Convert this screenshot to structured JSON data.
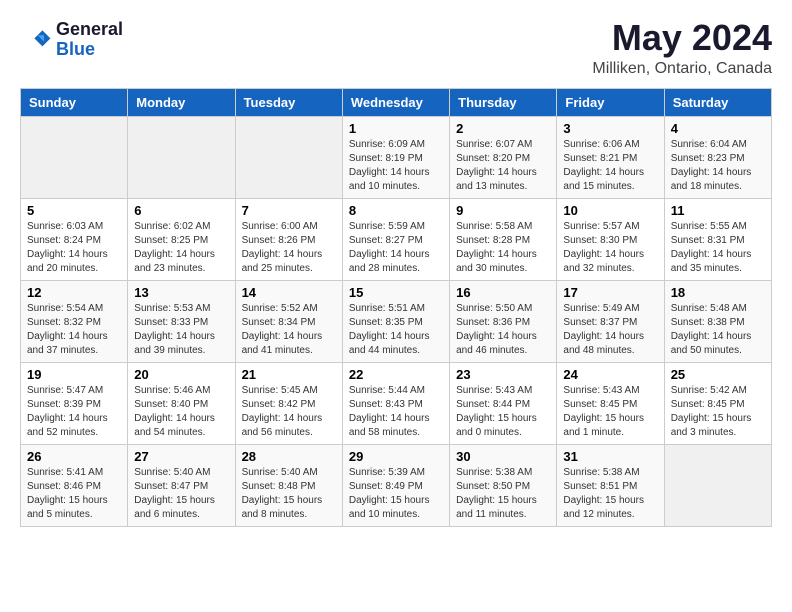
{
  "header": {
    "logo_line1": "General",
    "logo_line2": "Blue",
    "month": "May 2024",
    "location": "Milliken, Ontario, Canada"
  },
  "days_of_week": [
    "Sunday",
    "Monday",
    "Tuesday",
    "Wednesday",
    "Thursday",
    "Friday",
    "Saturday"
  ],
  "weeks": [
    [
      {
        "day": "",
        "info": ""
      },
      {
        "day": "",
        "info": ""
      },
      {
        "day": "",
        "info": ""
      },
      {
        "day": "1",
        "info": "Sunrise: 6:09 AM\nSunset: 8:19 PM\nDaylight: 14 hours\nand 10 minutes."
      },
      {
        "day": "2",
        "info": "Sunrise: 6:07 AM\nSunset: 8:20 PM\nDaylight: 14 hours\nand 13 minutes."
      },
      {
        "day": "3",
        "info": "Sunrise: 6:06 AM\nSunset: 8:21 PM\nDaylight: 14 hours\nand 15 minutes."
      },
      {
        "day": "4",
        "info": "Sunrise: 6:04 AM\nSunset: 8:23 PM\nDaylight: 14 hours\nand 18 minutes."
      }
    ],
    [
      {
        "day": "5",
        "info": "Sunrise: 6:03 AM\nSunset: 8:24 PM\nDaylight: 14 hours\nand 20 minutes."
      },
      {
        "day": "6",
        "info": "Sunrise: 6:02 AM\nSunset: 8:25 PM\nDaylight: 14 hours\nand 23 minutes."
      },
      {
        "day": "7",
        "info": "Sunrise: 6:00 AM\nSunset: 8:26 PM\nDaylight: 14 hours\nand 25 minutes."
      },
      {
        "day": "8",
        "info": "Sunrise: 5:59 AM\nSunset: 8:27 PM\nDaylight: 14 hours\nand 28 minutes."
      },
      {
        "day": "9",
        "info": "Sunrise: 5:58 AM\nSunset: 8:28 PM\nDaylight: 14 hours\nand 30 minutes."
      },
      {
        "day": "10",
        "info": "Sunrise: 5:57 AM\nSunset: 8:30 PM\nDaylight: 14 hours\nand 32 minutes."
      },
      {
        "day": "11",
        "info": "Sunrise: 5:55 AM\nSunset: 8:31 PM\nDaylight: 14 hours\nand 35 minutes."
      }
    ],
    [
      {
        "day": "12",
        "info": "Sunrise: 5:54 AM\nSunset: 8:32 PM\nDaylight: 14 hours\nand 37 minutes."
      },
      {
        "day": "13",
        "info": "Sunrise: 5:53 AM\nSunset: 8:33 PM\nDaylight: 14 hours\nand 39 minutes."
      },
      {
        "day": "14",
        "info": "Sunrise: 5:52 AM\nSunset: 8:34 PM\nDaylight: 14 hours\nand 41 minutes."
      },
      {
        "day": "15",
        "info": "Sunrise: 5:51 AM\nSunset: 8:35 PM\nDaylight: 14 hours\nand 44 minutes."
      },
      {
        "day": "16",
        "info": "Sunrise: 5:50 AM\nSunset: 8:36 PM\nDaylight: 14 hours\nand 46 minutes."
      },
      {
        "day": "17",
        "info": "Sunrise: 5:49 AM\nSunset: 8:37 PM\nDaylight: 14 hours\nand 48 minutes."
      },
      {
        "day": "18",
        "info": "Sunrise: 5:48 AM\nSunset: 8:38 PM\nDaylight: 14 hours\nand 50 minutes."
      }
    ],
    [
      {
        "day": "19",
        "info": "Sunrise: 5:47 AM\nSunset: 8:39 PM\nDaylight: 14 hours\nand 52 minutes."
      },
      {
        "day": "20",
        "info": "Sunrise: 5:46 AM\nSunset: 8:40 PM\nDaylight: 14 hours\nand 54 minutes."
      },
      {
        "day": "21",
        "info": "Sunrise: 5:45 AM\nSunset: 8:42 PM\nDaylight: 14 hours\nand 56 minutes."
      },
      {
        "day": "22",
        "info": "Sunrise: 5:44 AM\nSunset: 8:43 PM\nDaylight: 14 hours\nand 58 minutes."
      },
      {
        "day": "23",
        "info": "Sunrise: 5:43 AM\nSunset: 8:44 PM\nDaylight: 15 hours\nand 0 minutes."
      },
      {
        "day": "24",
        "info": "Sunrise: 5:43 AM\nSunset: 8:45 PM\nDaylight: 15 hours\nand 1 minute."
      },
      {
        "day": "25",
        "info": "Sunrise: 5:42 AM\nSunset: 8:45 PM\nDaylight: 15 hours\nand 3 minutes."
      }
    ],
    [
      {
        "day": "26",
        "info": "Sunrise: 5:41 AM\nSunset: 8:46 PM\nDaylight: 15 hours\nand 5 minutes."
      },
      {
        "day": "27",
        "info": "Sunrise: 5:40 AM\nSunset: 8:47 PM\nDaylight: 15 hours\nand 6 minutes."
      },
      {
        "day": "28",
        "info": "Sunrise: 5:40 AM\nSunset: 8:48 PM\nDaylight: 15 hours\nand 8 minutes."
      },
      {
        "day": "29",
        "info": "Sunrise: 5:39 AM\nSunset: 8:49 PM\nDaylight: 15 hours\nand 10 minutes."
      },
      {
        "day": "30",
        "info": "Sunrise: 5:38 AM\nSunset: 8:50 PM\nDaylight: 15 hours\nand 11 minutes."
      },
      {
        "day": "31",
        "info": "Sunrise: 5:38 AM\nSunset: 8:51 PM\nDaylight: 15 hours\nand 12 minutes."
      },
      {
        "day": "",
        "info": ""
      }
    ]
  ]
}
